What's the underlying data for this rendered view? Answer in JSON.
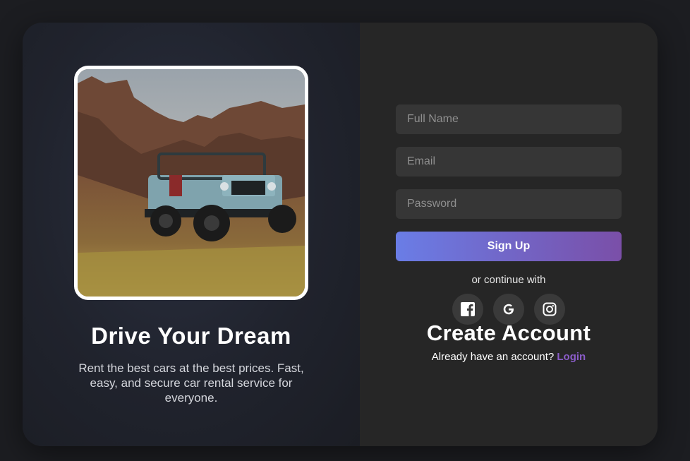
{
  "hero": {
    "title": "Drive Your Dream",
    "subtitle": "Rent the best cars at the best prices. Fast, easy, and secure car rental service for everyone."
  },
  "form": {
    "full_name_placeholder": "Full Name",
    "email_placeholder": "Email",
    "password_placeholder": "Password",
    "signup_label": "Sign Up",
    "or_text": "or continue with",
    "socials": [
      {
        "icon": "facebook-icon"
      },
      {
        "icon": "google-icon"
      },
      {
        "icon": "instagram-icon"
      }
    ],
    "title": "Create Account",
    "already_text": "Already have an account?",
    "login_label": "Login"
  },
  "colors": {
    "signup_gradient_start": "#6a7de6",
    "signup_gradient_end": "#7a4fa8",
    "login_link": "#8a5cc8",
    "right_panel": "#262626",
    "input_bg": "#363636"
  }
}
